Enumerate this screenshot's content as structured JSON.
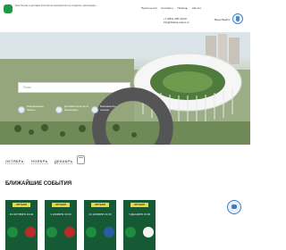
{
  "header": {
    "tagline": [
      "Бесплатная и доставка билетов на мероприятия на стадионе «Краснодар»"
    ],
    "nav": [
      "Пресс-центр",
      "Контакты",
      "Помощь",
      "Как это"
    ],
    "contacts": [
      "+7 (861) 205-15-00",
      "info@tickets.arena.ru"
    ],
    "login": "Вход/ Выйти"
  },
  "hero": {
    "search_placeholder": "Поиск",
    "features": [
      "Официальные билеты",
      "Доставка билетов по Краснодару",
      "Безопасность покупки"
    ]
  },
  "months": [
    "ОКТЯБРЬ",
    "НОЯБРЬ",
    "ДЕКАБРЬ"
  ],
  "events_title": "БЛИЖАЙШИЕ СОБЫТИЯ",
  "events": [
    {
      "badge": "ФУТБОЛ",
      "date": "03 ОКТЯБРЯ 19:00"
    },
    {
      "badge": "ФУТБОЛ",
      "date": "3 НОЯБРЯ 19:00"
    },
    {
      "badge": "ФУТБОЛ",
      "date": "24 НОЯБРЯ 19:00"
    },
    {
      "badge": "ФУТБОЛ",
      "date": "7 ДЕКАБРЯ 19:00"
    }
  ],
  "icons": {
    "logo": "site-logo",
    "search": "search-icon",
    "calendar": "calendar-icon",
    "chat": "chat-icon"
  },
  "colors": {
    "brand_green": "#1e9a46",
    "card_green": "#155a34",
    "badge_yellow": "#f0d43d",
    "accent_blue": "#3b7dc3"
  }
}
